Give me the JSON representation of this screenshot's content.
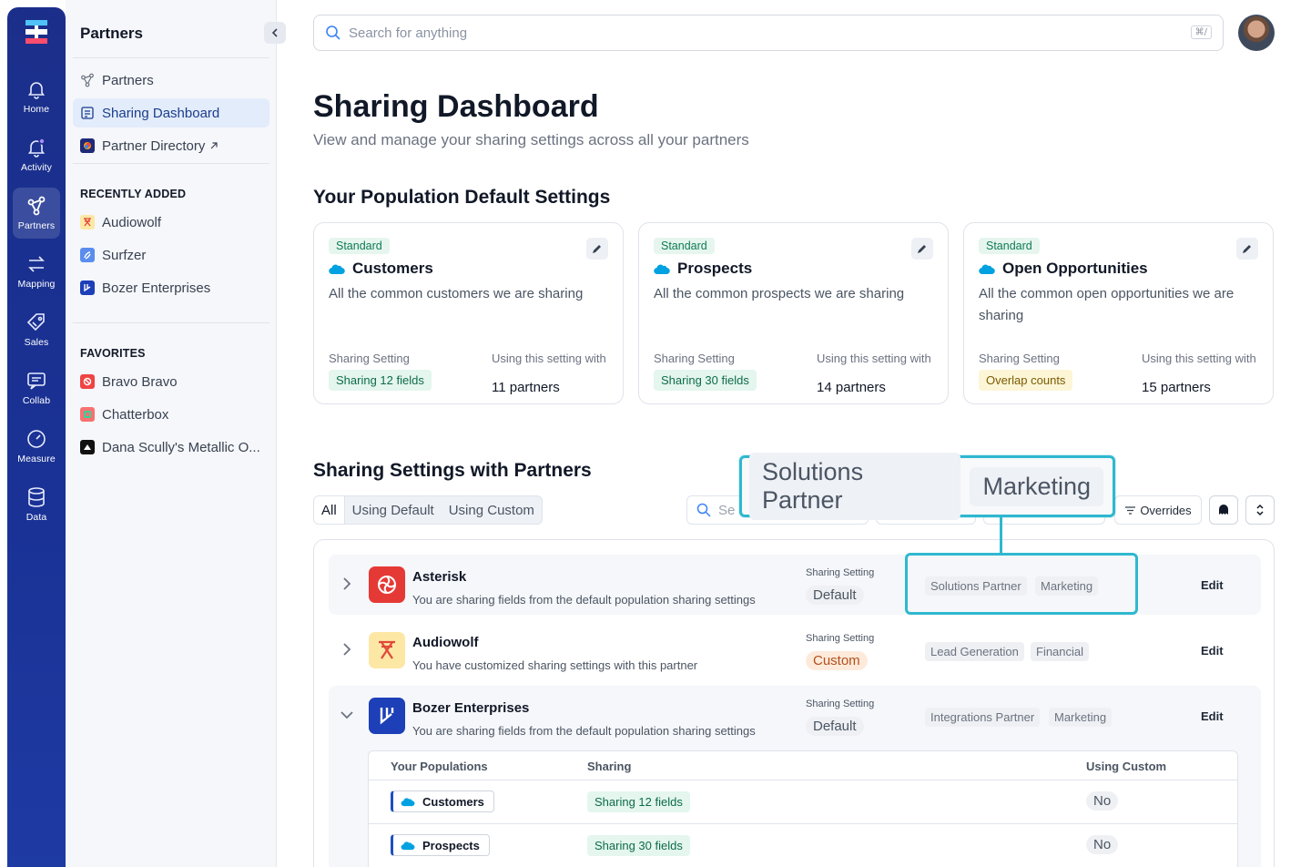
{
  "rail": {
    "items": [
      {
        "label": "Home",
        "icon": "bell-icon"
      },
      {
        "label": "Activity",
        "icon": "bell-notification-icon"
      },
      {
        "label": "Partners",
        "icon": "partners-network-icon"
      },
      {
        "label": "Mapping",
        "icon": "arrows-swap-icon"
      },
      {
        "label": "Sales",
        "icon": "tag-icon"
      },
      {
        "label": "Collab",
        "icon": "chat-icon"
      },
      {
        "label": "Measure",
        "icon": "gauge-icon"
      },
      {
        "label": "Data",
        "icon": "database-icon"
      }
    ]
  },
  "sidebar": {
    "title": "Partners",
    "nav": [
      {
        "label": "Partners"
      },
      {
        "label": "Sharing Dashboard"
      },
      {
        "label": "Partner Directory"
      }
    ],
    "recent_heading": "RECENTLY ADDED",
    "recent": [
      {
        "label": "Audiowolf"
      },
      {
        "label": "Surfzer"
      },
      {
        "label": "Bozer Enterprises"
      }
    ],
    "favorites_heading": "FAVORITES",
    "favorites": [
      {
        "label": "Bravo Bravo"
      },
      {
        "label": "Chatterbox"
      },
      {
        "label": "Dana Scully's Metallic O..."
      }
    ]
  },
  "search": {
    "placeholder": "Search for anything",
    "shortcut": "⌘/"
  },
  "page": {
    "title": "Sharing Dashboard",
    "subtitle": "View and manage your sharing settings across all your partners"
  },
  "defaults": {
    "title": "Your Population Default Settings",
    "cards": [
      {
        "badge": "Standard",
        "name": "Customers",
        "desc": "All the common customers we are sharing",
        "setting_label": "Sharing Setting",
        "setting_value": "Sharing 12 fields",
        "using_label": "Using this setting with",
        "using_value": "11 partners"
      },
      {
        "badge": "Standard",
        "name": "Prospects",
        "desc": "All the common prospects we are sharing",
        "setting_label": "Sharing Setting",
        "setting_value": "Sharing 30 fields",
        "using_label": "Using this setting with",
        "using_value": "14 partners"
      },
      {
        "badge": "Standard",
        "name": "Open Opportunities",
        "desc": "All the common open opportunities we are sharing",
        "setting_label": "Sharing Setting",
        "setting_value": "Overlap counts",
        "using_label": "Using this setting with",
        "using_value": "15 partners"
      }
    ]
  },
  "partners_section": {
    "title": "Sharing Settings with Partners",
    "tabs": [
      "All",
      "Using Default",
      "Using Custom"
    ],
    "search_placeholder": "Se",
    "overrides_label": "Overrides",
    "zoom_tags": [
      "Solutions Partner",
      "Marketing"
    ],
    "rows": [
      {
        "name": "Asterisk",
        "desc": "You are sharing fields from the default population sharing settings",
        "setting_label": "Sharing Setting",
        "setting": "Default",
        "tags": [
          "Solutions Partner",
          "Marketing"
        ],
        "edit": "Edit"
      },
      {
        "name": "Audiowolf",
        "desc": "You have customized sharing settings with this partner",
        "setting_label": "Sharing Setting",
        "setting": "Custom",
        "tags": [
          "Lead Generation",
          "Financial"
        ],
        "edit": "Edit"
      },
      {
        "name": "Bozer Enterprises",
        "desc": "You are sharing fields from the default population sharing settings",
        "setting_label": "Sharing Setting",
        "setting": "Default",
        "tags": [
          "Integrations Partner",
          "Marketing"
        ],
        "edit": "Edit"
      }
    ],
    "inner_table": {
      "headers": [
        "Your Populations",
        "Sharing",
        "Using Custom"
      ],
      "rows": [
        {
          "population": "Customers",
          "sharing": "Sharing 12 fields",
          "custom": "No"
        },
        {
          "population": "Prospects",
          "sharing": "Sharing 30 fields",
          "custom": "No"
        }
      ]
    }
  },
  "colors": {
    "rail": "#1b2f8a",
    "accent": "#2fb8cf",
    "active_bg": "#e3ecfb",
    "salesforce": "#00a1e0"
  }
}
